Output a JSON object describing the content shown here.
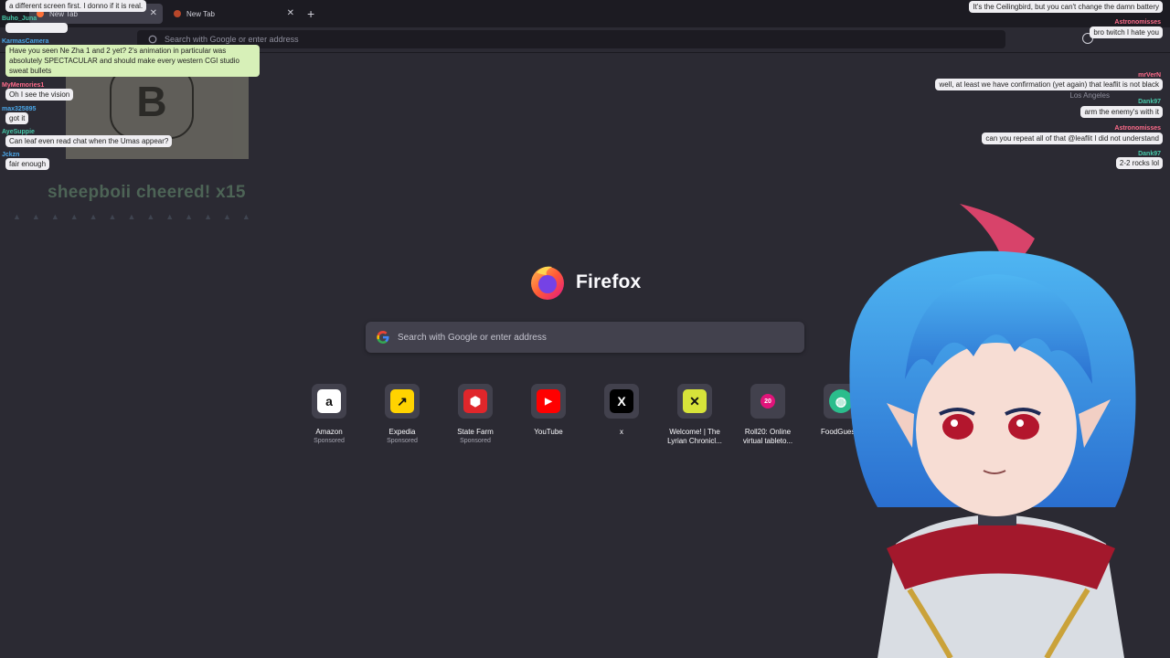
{
  "browser": {
    "tabs": [
      {
        "label": "New Tab",
        "active": true
      },
      {
        "label": "New Tab",
        "active": false
      }
    ],
    "new_tab_symbol": "+",
    "urlbar_placeholder": "Search with Google or enter address"
  },
  "newtab": {
    "brand_name": "Firefox",
    "search_placeholder": "Search with Google or enter address",
    "shortcuts": [
      {
        "title": "Amazon",
        "sponsored": "Sponsored",
        "icon": "amazon-icon",
        "glyph": "a",
        "bg": "#ffffff",
        "fg": "#111111"
      },
      {
        "title": "Expedia",
        "sponsored": "Sponsored",
        "icon": "expedia-icon",
        "glyph": "↗",
        "bg": "#ffd300",
        "fg": "#111111"
      },
      {
        "title": "State Farm",
        "sponsored": "Sponsored",
        "icon": "statefarm-icon",
        "glyph": "⬢",
        "bg": "#e0262b",
        "fg": "#ffffff"
      },
      {
        "title": "YouTube",
        "sponsored": "",
        "icon": "youtube-icon",
        "glyph": "▶",
        "bg": "#ff0000",
        "fg": "#ffffff"
      },
      {
        "title": "x",
        "sponsored": "",
        "icon": "x-icon",
        "glyph": "X",
        "bg": "#000000",
        "fg": "#ffffff"
      },
      {
        "title": "Welcome! | The Lyrian Chronicl...",
        "sponsored": "",
        "icon": "lyrian-icon",
        "glyph": "✕",
        "bg": "#d7e33a",
        "fg": "#111111"
      },
      {
        "title": "Roll20: Online virtual tableto...",
        "sponsored": "",
        "icon": "roll20-icon",
        "glyph": "20",
        "bg": "#e1147a",
        "fg": "#ffffff"
      },
      {
        "title": "FoodGuessr",
        "sponsored": "",
        "icon": "globe-icon",
        "glyph": "◍",
        "bg": "#2bbd8c",
        "fg": "#ffffff"
      }
    ]
  },
  "overlay": {
    "chat_left": [
      {
        "user": "",
        "text": "a different screen first. I donno if it is real.",
        "style": "white"
      },
      {
        "user": "Buho_Juna",
        "text": "",
        "style": "white"
      },
      {
        "user": "KarmasCamera",
        "text": "Have you seen Ne Zha 1 and 2 yet? 2's animation in particular was absolutely SPECTACULAR and should make every western CGI studio sweat bullets",
        "style": "green"
      },
      {
        "user": "MyMemories1",
        "text": "Oh I see the vision",
        "style": "white"
      },
      {
        "user": "max325895",
        "text": "got it",
        "style": "white"
      },
      {
        "user": "AyeSuppie",
        "text": "Can leaf even read chat when the Umas appear?",
        "style": "white"
      },
      {
        "user": "Jckzn",
        "text": "fair enough",
        "style": "white"
      }
    ],
    "cheer_text": "sheepboii cheered! x15",
    "card_letter": "B",
    "chat_right": [
      {
        "user": "",
        "text": "It's the Ceilingbird, but you can't change the damn battery"
      },
      {
        "user": "Astronomisses",
        "text": "bro twitch I hate you"
      },
      {
        "user": "mrVerN",
        "text": "well, at least we have confirmation (yet again) that leaflit is not black"
      },
      {
        "user": "Dank97",
        "text": "arm the enemy's with it"
      },
      {
        "user": "Astronomisses",
        "text": "can you repeat all of that @leaflit I did not understand"
      },
      {
        "user": "Dank97",
        "text": "2-2 rocks lol"
      }
    ],
    "location_text": "Los Angeles"
  },
  "colors": {
    "page_bg": "#2b2a33",
    "tab_strip": "#1c1b22",
    "tile_bg": "#42414d",
    "accent_firefox": "#ff7139"
  }
}
